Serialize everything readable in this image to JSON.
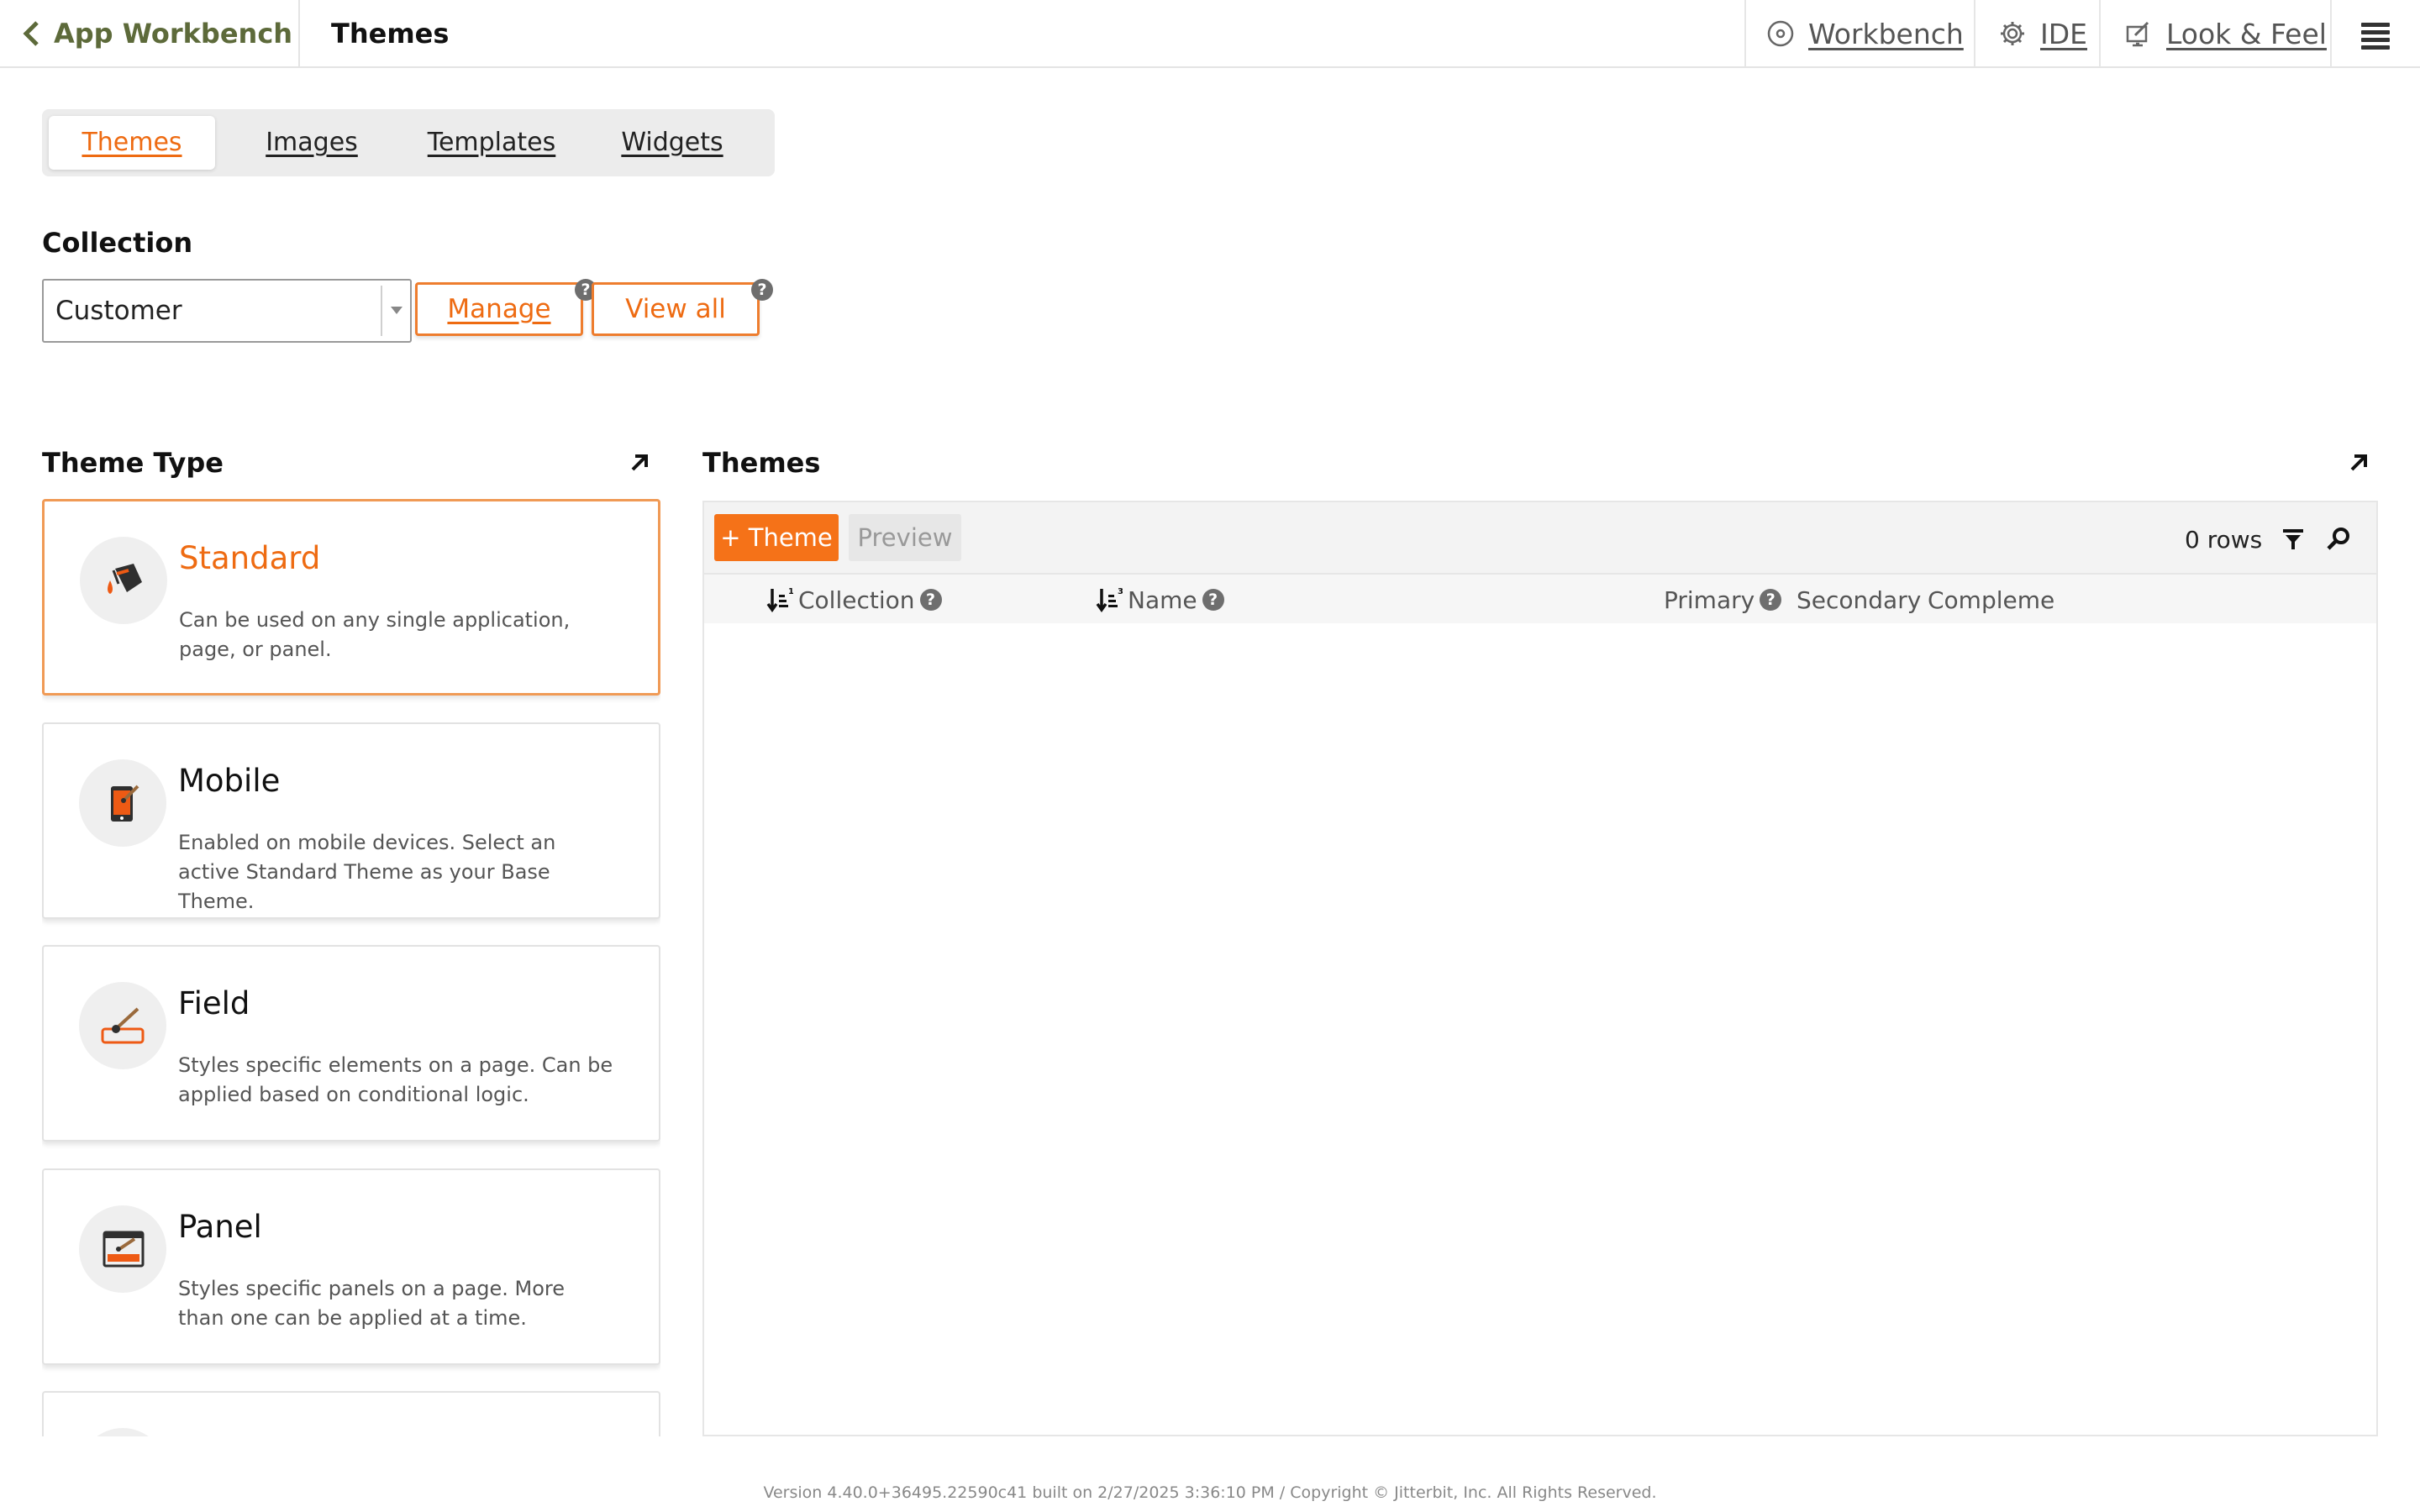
{
  "topbar": {
    "back_label": "App Workbench",
    "page_title": "Themes",
    "nav": [
      {
        "label": "Workbench",
        "icon": "workbench-icon"
      },
      {
        "label": "IDE",
        "icon": "gear-icon"
      },
      {
        "label": "Look & Feel",
        "icon": "look-feel-icon"
      }
    ],
    "menu_icon": "hamburger-menu-icon"
  },
  "tabs": [
    {
      "label": "Themes",
      "active": true
    },
    {
      "label": "Images",
      "active": false
    },
    {
      "label": "Templates",
      "active": false
    },
    {
      "label": "Widgets",
      "active": false
    }
  ],
  "collection": {
    "label": "Collection",
    "selected": "Customer",
    "manage_label": "Manage",
    "view_all_label": "View all",
    "help_glyph": "?"
  },
  "theme_type": {
    "title": "Theme Type",
    "cards": [
      {
        "title": "Standard",
        "desc": "Can be used on any single application, page, or panel.",
        "icon": "paint-bucket-icon",
        "selected": true
      },
      {
        "title": "Mobile",
        "desc": "Enabled on mobile devices. Select an active Standard Theme as your Base Theme.",
        "icon": "mobile-brush-icon",
        "selected": false
      },
      {
        "title": "Field",
        "desc": "Styles specific elements on a page. Can be applied based on conditional logic.",
        "icon": "field-brush-icon",
        "selected": false
      },
      {
        "title": "Panel",
        "desc": "Styles specific panels on a page. More than one can be applied at a time.",
        "icon": "panel-brush-icon",
        "selected": false
      }
    ]
  },
  "themes": {
    "title": "Themes",
    "add_label": "+ Theme",
    "preview_label": "Preview",
    "rows_label": "0 rows",
    "columns": [
      {
        "label": "Collection",
        "sort": "1",
        "help": true
      },
      {
        "label": "Name",
        "sort": "3",
        "help": true
      },
      {
        "label": "Primary",
        "sort": "",
        "help": true
      },
      {
        "label": "Secondary",
        "sort": "",
        "help": false
      },
      {
        "label": "Compleme",
        "sort": "",
        "help": false
      }
    ]
  },
  "colors": {
    "accent": "#f57218",
    "accent_text": "#ee6b12",
    "back_link": "#5d6a3a"
  },
  "footer": "Version 4.40.0+36495.22590c41 built on 2/27/2025 3:36:10 PM / Copyright © Jitterbit, Inc. All Rights Reserved."
}
